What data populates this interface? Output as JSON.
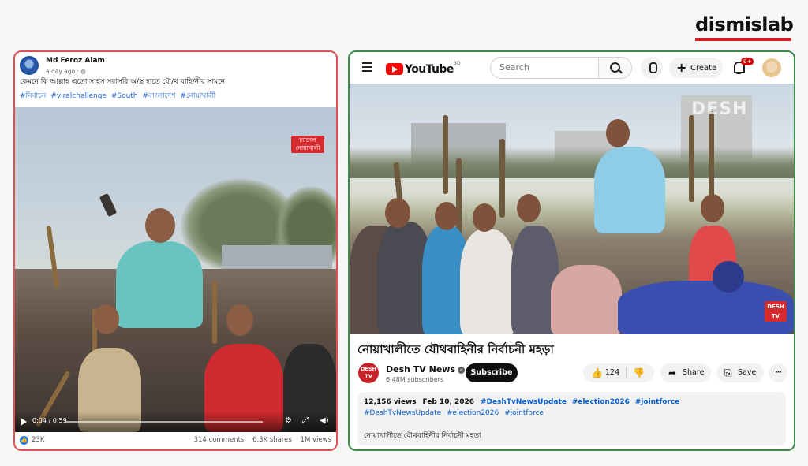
{
  "brand": {
    "name": "dismislab",
    "accent": "#d32027"
  },
  "facebook": {
    "author": "Md Feroz Alam",
    "time": "a day ago",
    "privacy_icon": "globe-icon",
    "caption": "কেমনে কি আল্লাহ এতো সাহস সরাসরি অ/স্ত্র হাতে যৌ/থ বাহি/নীর সামনে",
    "hashtags": [
      "#নির্বাচন",
      "#viralchallenge",
      "#South",
      "#বাংলাদেশ",
      "#নোয়াখালী"
    ],
    "watermark": "চ্যানেল নোয়াখালী",
    "video_time": "0:04 / 0:59",
    "reactions": "23K",
    "comments": "314 comments",
    "shares": "6.3K shares",
    "views": "1M views",
    "border_color": "#e05059"
  },
  "youtube": {
    "logo_text": "YouTube",
    "region": "BD",
    "search_placeholder": "Search",
    "create_label": "Create",
    "notifications": "9+",
    "video_watermark": "DESH",
    "corner_logo": "DESH TV",
    "title": "নোয়াখালীতে যৌথবাহিনীর নির্বাচনী মহড়া",
    "channel": "Desh TV News",
    "channel_avatar": "DESH TV",
    "subscribers": "6.48M subscribers",
    "subscribe_label": "Subscribe",
    "likes": "124",
    "share_label": "Share",
    "save_label": "Save",
    "views": "12,156 views",
    "date": "Feb 10, 2026",
    "tags_line1": [
      "#DeshTvNewsUpdate",
      "#election2026",
      "#jointforce"
    ],
    "tags_line2": [
      "#DeshTvNewsUpdate",
      "#election2026",
      "#jointforce"
    ],
    "description": "নোয়াখালীতে যৌথবাহিনীর নির্বাচনী মহড়া",
    "border_color": "#3c8c4b"
  }
}
